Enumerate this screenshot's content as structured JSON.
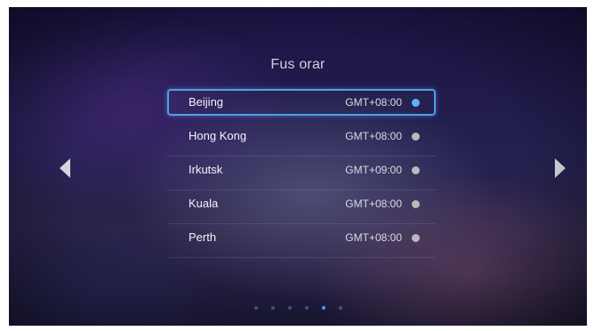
{
  "title": "Fus orar",
  "timezones": [
    {
      "city": "Beijing",
      "offset": "GMT+08:00",
      "selected": true
    },
    {
      "city": "Hong Kong",
      "offset": "GMT+08:00",
      "selected": false
    },
    {
      "city": "Irkutsk",
      "offset": "GMT+09:00",
      "selected": false
    },
    {
      "city": "Kuala",
      "offset": "GMT+08:00",
      "selected": false
    },
    {
      "city": "Perth",
      "offset": "GMT+08:00",
      "selected": false
    }
  ],
  "pager": {
    "total": 6,
    "active_index": 4
  },
  "colors": {
    "accent": "#4f9fe6",
    "radio_selected": "#5eb0ff",
    "radio_unselected": "#b8b9c0"
  },
  "icons": {
    "left": "chevron-left-icon",
    "right": "chevron-right-icon"
  }
}
